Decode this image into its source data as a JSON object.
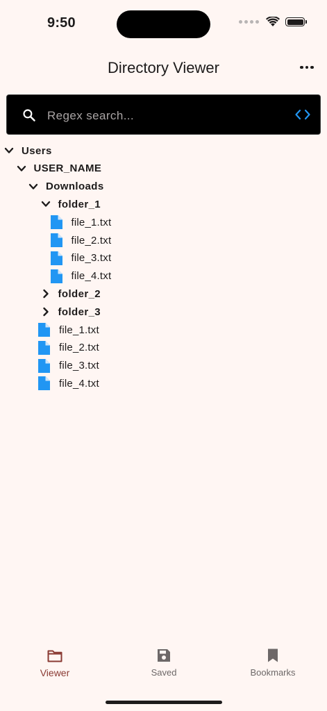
{
  "status_bar": {
    "time": "9:50"
  },
  "app_bar": {
    "title": "Directory Viewer"
  },
  "search": {
    "placeholder": "Regex search...",
    "value": ""
  },
  "tree": [
    {
      "type": "folder",
      "label": "Users",
      "expanded": true,
      "depth": 0
    },
    {
      "type": "folder",
      "label": "USER_NAME",
      "expanded": true,
      "depth": 1
    },
    {
      "type": "folder",
      "label": "Downloads",
      "expanded": true,
      "depth": 2
    },
    {
      "type": "folder",
      "label": "folder_1",
      "expanded": true,
      "depth": 3
    },
    {
      "type": "file",
      "label": "file_1.txt",
      "depth": 4
    },
    {
      "type": "file",
      "label": "file_2.txt",
      "depth": 4
    },
    {
      "type": "file",
      "label": "file_3.txt",
      "depth": 4
    },
    {
      "type": "file",
      "label": "file_4.txt",
      "depth": 4
    },
    {
      "type": "folder",
      "label": "folder_2",
      "expanded": false,
      "depth": 3
    },
    {
      "type": "folder",
      "label": "folder_3",
      "expanded": false,
      "depth": 3
    },
    {
      "type": "file",
      "label": "file_1.txt",
      "depth": 3
    },
    {
      "type": "file",
      "label": "file_2.txt",
      "depth": 3
    },
    {
      "type": "file",
      "label": "file_3.txt",
      "depth": 3
    },
    {
      "type": "file",
      "label": "file_4.txt",
      "depth": 3
    }
  ],
  "bottom_nav": {
    "items": [
      {
        "label": "Viewer",
        "icon": "folder-icon",
        "active": true
      },
      {
        "label": "Saved",
        "icon": "save-icon",
        "active": false
      },
      {
        "label": "Bookmarks",
        "icon": "bookmark-icon",
        "active": false
      }
    ]
  },
  "colors": {
    "background": "#fff6f3",
    "file_icon": "#2196f3",
    "active_nav": "#8a3a33",
    "inactive_nav": "#6d6868",
    "search_bg": "#000000",
    "code_icon": "#2196f3"
  }
}
